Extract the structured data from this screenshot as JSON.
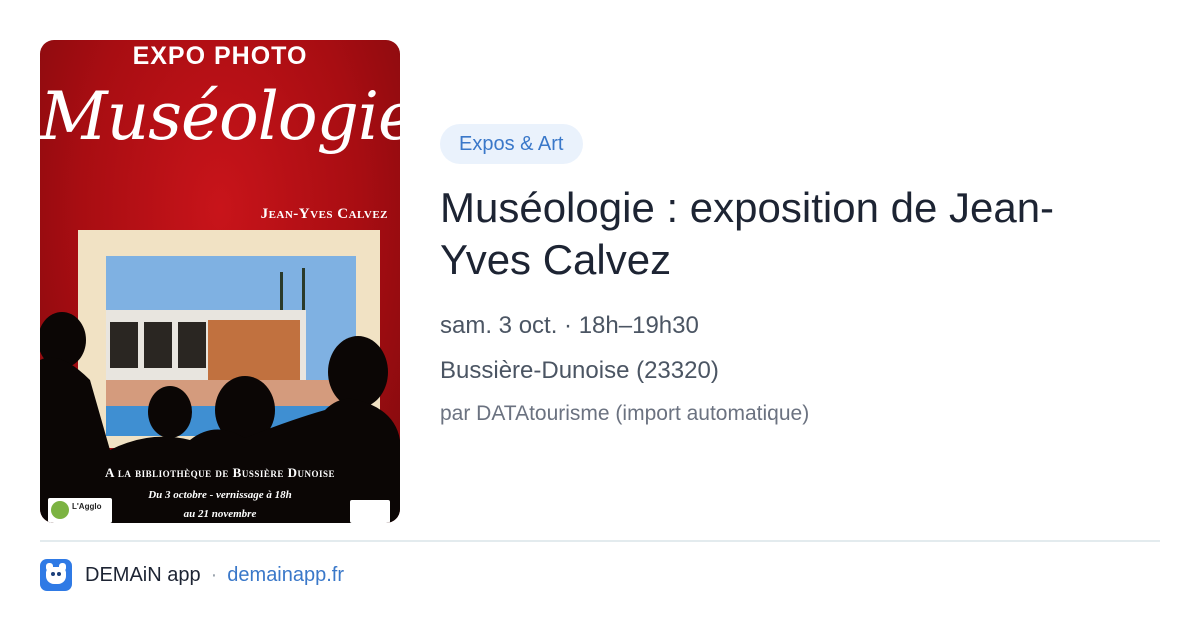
{
  "poster": {
    "heading": "EXPO PHOTO",
    "script_title": "Muséologie",
    "artist": "Jean-Yves Calvez",
    "venue": "A la bibliothèque de Bussière Dunoise",
    "dates_line1": "Du 3 octobre - vernissage à 18h",
    "dates_line2": "au 21 novembre",
    "logo_left_text": "L'Agglo"
  },
  "card": {
    "category": "Expos & Art",
    "title": "Muséologie : exposition de Jean-Yves Calvez",
    "datetime": "sam. 3 oct. · 18h–19h30",
    "location": "Bussière-Dunoise (23320)",
    "source": "par DATAtourisme (import automatique)"
  },
  "footer": {
    "app_name": "DEMAiN app",
    "separator": "·",
    "url": "demainapp.fr",
    "app_icon": "bear-face-icon"
  },
  "colors": {
    "accent": "#3a78c9",
    "badge_bg": "#eaf2fc",
    "poster_red": "#b0101a",
    "title": "#1d2433"
  }
}
